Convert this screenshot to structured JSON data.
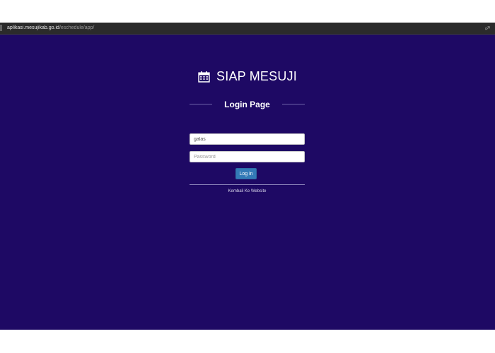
{
  "browser": {
    "url_host": "aplikasi.mesujikab.go.id",
    "url_path": "/eschedule/app/"
  },
  "brand": {
    "icon": "calendar-icon",
    "title": "SIAP MESUJI"
  },
  "login": {
    "heading": "Login Page",
    "username_value": "galas",
    "password_placeholder": "Password",
    "submit_label": "Log in",
    "back_link": "Kembali Ke Website"
  },
  "colors": {
    "page_background": "#1e0964",
    "button": "#337ab7",
    "text": "#ffffff"
  }
}
